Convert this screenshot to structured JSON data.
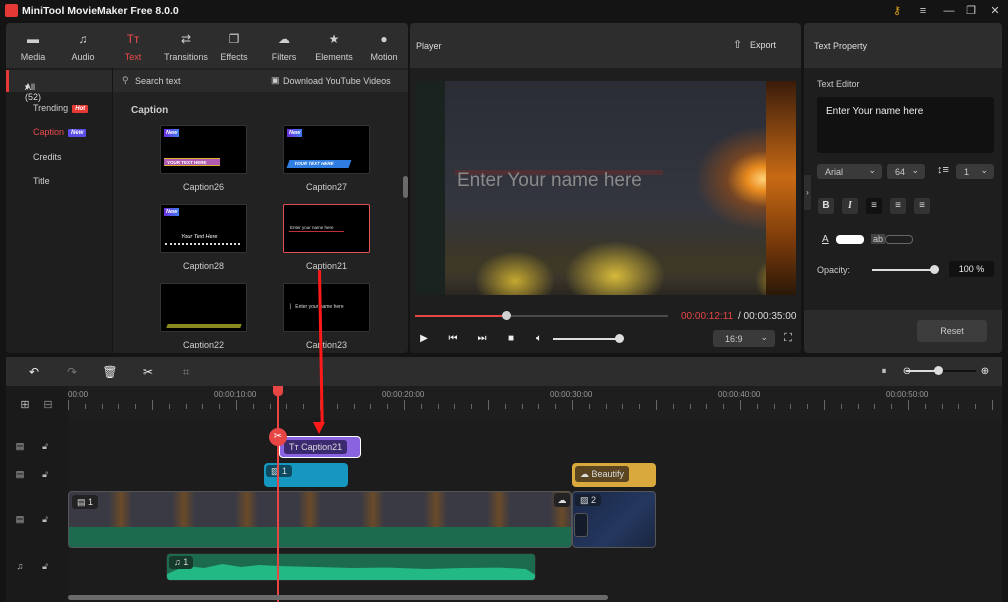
{
  "app": {
    "title": "MiniTool MovieMaker Free 8.0.0"
  },
  "window_controls": [
    {
      "name": "key-icon",
      "glyph": "⚷"
    },
    {
      "name": "menu-icon",
      "glyph": "≡"
    },
    {
      "name": "minimize-icon",
      "glyph": "—"
    },
    {
      "name": "restore-icon",
      "glyph": "❐"
    },
    {
      "name": "close-icon",
      "glyph": "✕"
    }
  ],
  "tabs": [
    {
      "label": "Media",
      "icon": "▬"
    },
    {
      "label": "Audio",
      "icon": "♫"
    },
    {
      "label": "Text",
      "icon": "Tт",
      "active": true
    },
    {
      "label": "Transitions",
      "icon": "⇄"
    },
    {
      "label": "Effects",
      "icon": "❐"
    },
    {
      "label": "Filters",
      "icon": "☁"
    },
    {
      "label": "Elements",
      "icon": "★"
    },
    {
      "label": "Motion",
      "icon": "●"
    }
  ],
  "categories": {
    "all": "All (52)",
    "items": [
      {
        "label": "Trending",
        "badge": "Hot",
        "badge_color": "#e53935"
      },
      {
        "label": "Caption",
        "badge": "New",
        "badge_color": "#5b4fe8",
        "active": true
      },
      {
        "label": "Credits"
      },
      {
        "label": "Title"
      }
    ]
  },
  "search": {
    "placeholder": "Search text",
    "download_label": "Download YouTube Videos"
  },
  "section_title": "Caption",
  "thumbnails": [
    {
      "label": "Caption26",
      "new": true,
      "preview_text": "YOUR TEXT HERE"
    },
    {
      "label": "Caption27",
      "new": true,
      "preview_text": "YOUR TEXT HERE"
    },
    {
      "label": "Caption28",
      "new": true,
      "preview_text": "Your Text Here"
    },
    {
      "label": "Caption21",
      "selected": true,
      "preview_text": "Enter your name here"
    },
    {
      "label": "Caption22",
      "preview_text": ""
    },
    {
      "label": "Caption23",
      "preview_text": "Enter your name here"
    }
  ],
  "new_badge": "New",
  "player": {
    "title": "Player",
    "export_label": "Export",
    "overlay_text": "Enter Your name here",
    "current_time": "00:00:12:11",
    "total_time": "/ 00:00:35:00",
    "progress": 0.36,
    "volume": 0.95,
    "aspect_ratio": "16:9"
  },
  "text_property": {
    "title": "Text Property",
    "editor_label": "Text Editor",
    "editor_value": "Enter Your name here",
    "font": "Arial",
    "size": "64",
    "line_spacing": "1",
    "format_buttons": [
      {
        "name": "bold-button",
        "glyph": "B"
      },
      {
        "name": "italic-button",
        "glyph": "I"
      },
      {
        "name": "align-left-button",
        "glyph": "≡",
        "active": true
      },
      {
        "name": "align-center-button",
        "glyph": "≡"
      },
      {
        "name": "align-right-button",
        "glyph": "≡"
      }
    ],
    "text_color_label": "A",
    "bg_label": "ab",
    "text_color": "#ffffff",
    "opacity_label": "Opacity:",
    "opacity_value": "100 %",
    "opacity": 1.0,
    "reset_label": "Reset"
  },
  "timeline": {
    "ruler_labels": [
      "00:00",
      "00:00:10:00",
      "00:00:20:00",
      "00:00:30:00",
      "00:00:40:00",
      "00:00:50:00"
    ],
    "playhead_time": "00:00:12:11",
    "zoom_level": 0.45,
    "clips": {
      "caption": {
        "label": "Caption21",
        "icon": "Tт"
      },
      "image1": {
        "label": "1"
      },
      "video1": {
        "label": "1"
      },
      "beautify": {
        "label": "Beautify"
      },
      "image2": {
        "label": "2"
      },
      "audio1": {
        "label": "1"
      }
    }
  },
  "colors": {
    "accent": "#e84545",
    "caption_clip": "#8a63e0",
    "image_clip": "#1597c0",
    "filter_clip": "#d9a93d",
    "audio_clip": "#22b985",
    "video_clip": "#1d6b4e"
  }
}
